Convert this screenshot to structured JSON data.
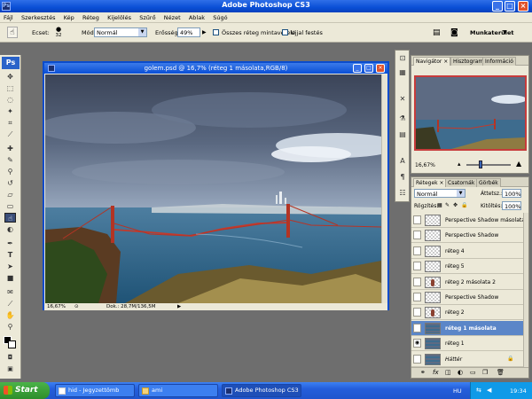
{
  "app": {
    "title": "Adobe Photoshop CS3",
    "icon_label": "Ps"
  },
  "menu": [
    "Fájl",
    "Szerkesztés",
    "Kép",
    "Réteg",
    "Kijelölés",
    "Szűrő",
    "Nézet",
    "Ablak",
    "Súgó"
  ],
  "options": {
    "brush_label": "Ecset:",
    "brush_size": "32",
    "mode_label": "Mód:",
    "mode_value": "Normál",
    "strength_label": "Erősség:",
    "strength_value": "49%",
    "sample_all_label": "Összes réteg mintavétele",
    "finger_label": "Ujjal festés",
    "workspace_label": "Munkaterület"
  },
  "document": {
    "title": "golem.psd @ 16,7% (réteg 1 másolata,RGB/8)",
    "zoom": "16,67%",
    "doc_size": "Dok.: 28,7M/136,5M"
  },
  "navigator": {
    "tabs": [
      "Navigátor",
      "Hisztogram",
      "Információ"
    ],
    "zoom": "16,67%"
  },
  "layers_panel": {
    "tabs": [
      "Rétegek",
      "Csatornák",
      "Görbék"
    ],
    "blend_mode": "Normál",
    "opacity_label": "Áttetsz.:",
    "opacity_value": "100%",
    "lock_label": "Rögzítés:",
    "fill_label": "Kitöltés:",
    "fill_value": "100%",
    "layers": [
      {
        "name": "Perspective Shadow másolata",
        "visible": false,
        "selected": false,
        "figure": false
      },
      {
        "name": "Perspective Shadow",
        "visible": false,
        "selected": false,
        "figure": false
      },
      {
        "name": "réteg 4",
        "visible": false,
        "selected": false,
        "figure": false
      },
      {
        "name": "réteg 5",
        "visible": false,
        "selected": false,
        "figure": false
      },
      {
        "name": "réteg 2 másolata 2",
        "visible": false,
        "selected": false,
        "figure": true
      },
      {
        "name": "Perspective Shadow",
        "visible": false,
        "selected": false,
        "figure": false
      },
      {
        "name": "réteg 2",
        "visible": false,
        "selected": false,
        "figure": true
      },
      {
        "name": "réteg 1 másolata",
        "visible": false,
        "selected": true,
        "figure": false
      },
      {
        "name": "réteg 1",
        "visible": true,
        "selected": false,
        "figure": false
      },
      {
        "name": "Háttér",
        "visible": false,
        "selected": false,
        "figure": false
      }
    ]
  },
  "taskbar": {
    "start": "Start",
    "tasks": [
      "hid - Jegyzettömb",
      "ami",
      "Adobe Photoshop CS3"
    ],
    "language": "HU",
    "clock": "19:34"
  }
}
